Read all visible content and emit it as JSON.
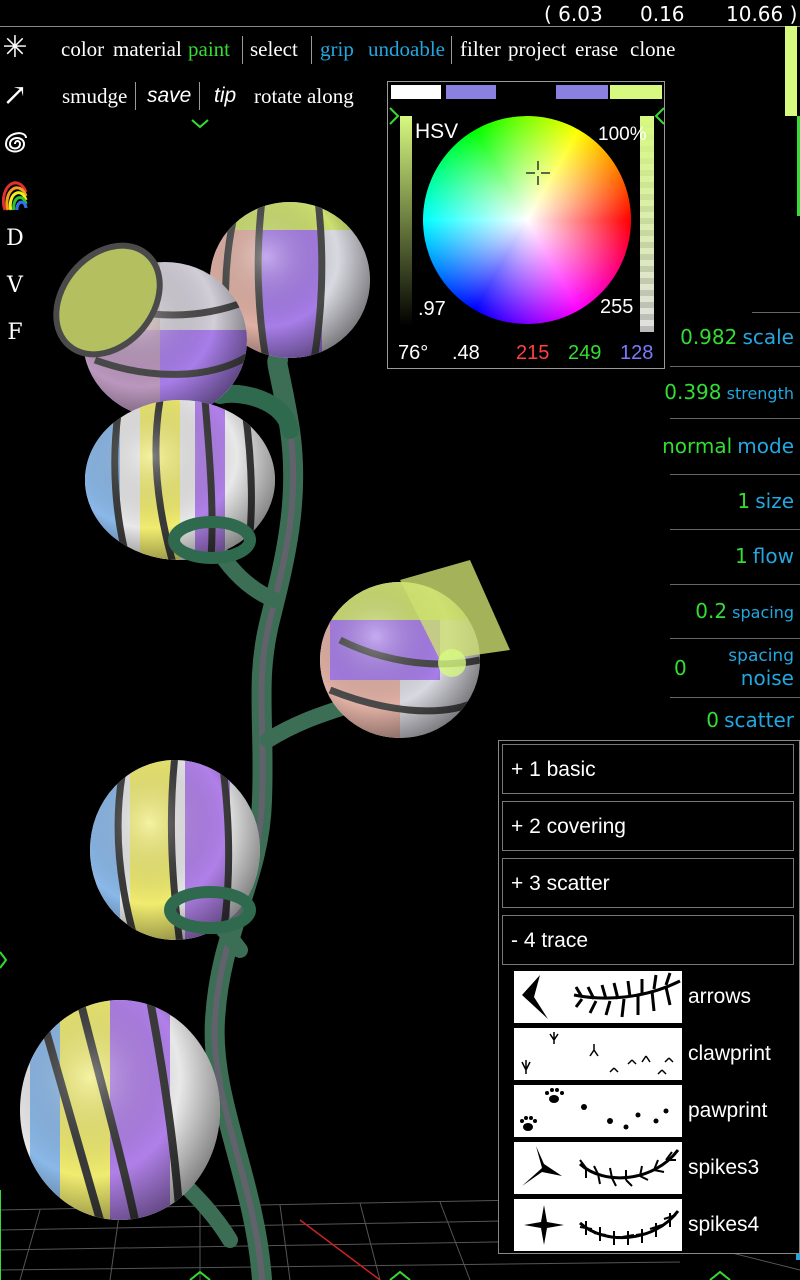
{
  "coordinates": {
    "x": "( 6.03",
    "y": "0.16",
    "z": "10.66 )"
  },
  "toolbar": {
    "tools": [
      {
        "name": "star-tool",
        "glyph": "✳"
      },
      {
        "name": "arrow-tool",
        "glyph": "↗"
      },
      {
        "name": "spiral-tool",
        "glyph": "@"
      },
      {
        "name": "rainbow-tool",
        "glyph": "rainbow"
      },
      {
        "name": "d-tool",
        "glyph": "D"
      },
      {
        "name": "v-tool",
        "glyph": "V"
      },
      {
        "name": "f-tool",
        "glyph": "F"
      }
    ]
  },
  "menu": {
    "color": "color",
    "material": "material",
    "paint": "paint",
    "select": "select",
    "grip": "grip",
    "undoable": "undoable",
    "filter": "filter",
    "project": "project",
    "erase": "erase",
    "clone": "clone",
    "smudge": "smudge",
    "save": "save",
    "tip": "tip",
    "rotate_along": "rotate along"
  },
  "color_picker": {
    "mode": "HSV",
    "percent": "100%",
    "value": ".97",
    "alpha": "255",
    "hue": "76°",
    "saturation": ".48",
    "r": "215",
    "g": "249",
    "b": "128",
    "current_color": "#d7f980",
    "swatches": [
      "#ffffff",
      "#8a80e0",
      "#000000",
      "#8a80e0",
      "#d7f980"
    ]
  },
  "brush_params": [
    {
      "value": "0.982",
      "label": "scale",
      "small": false
    },
    {
      "value": "0.398",
      "label": "strength",
      "small": true
    },
    {
      "value": "normal",
      "label": "mode",
      "small": false
    },
    {
      "value": "1",
      "label": "size",
      "small": false
    },
    {
      "value": "1",
      "label": "flow",
      "small": false
    },
    {
      "value": "0.2",
      "label": "spacing",
      "small": true
    },
    {
      "value": "0",
      "label": "spacing",
      "label2": "noise",
      "small": true
    },
    {
      "value": "0",
      "label": "scatter",
      "small": false
    }
  ],
  "brush_categories": [
    {
      "label": "+ 1 basic"
    },
    {
      "label": "+ 2 covering"
    },
    {
      "label": "+ 3 scatter"
    },
    {
      "label": "- 4 trace"
    }
  ],
  "brushes": [
    {
      "label": "arrows",
      "icon": "arrows-icon"
    },
    {
      "label": "clawprint",
      "icon": "clawprint-icon"
    },
    {
      "label": "pawprint",
      "icon": "pawprint-icon"
    },
    {
      "label": "spikes3",
      "icon": "spikes3-icon"
    },
    {
      "label": "spikes4",
      "icon": "spikes4-icon"
    }
  ]
}
